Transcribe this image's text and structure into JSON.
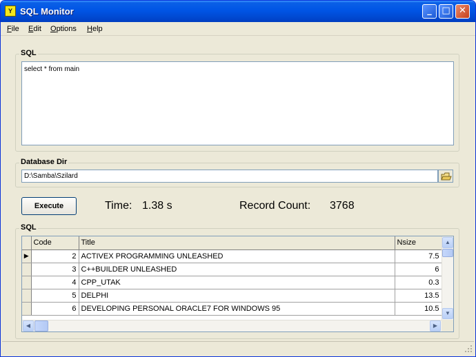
{
  "window": {
    "title": "SQL Monitor",
    "app_icon_glyph": "Y",
    "minimize": "_",
    "maximize": "□",
    "close": "✕"
  },
  "menu": [
    {
      "key": "F",
      "rest": "ile"
    },
    {
      "key": "E",
      "rest": "dit"
    },
    {
      "key": "O",
      "rest": "ptions"
    },
    {
      "key": "H",
      "rest": "elp"
    }
  ],
  "sql_group": {
    "label": "SQL",
    "query": "select * from main"
  },
  "dir_group": {
    "label": "Database Dir",
    "path": "D:\\Samba\\Szilard"
  },
  "actions": {
    "execute_label": "Execute"
  },
  "stats": {
    "time_label": "Time:",
    "time_value": "1.38 s",
    "count_label": "Record Count:",
    "count_value": "3768"
  },
  "results_group": {
    "label": "SQL",
    "columns": [
      "Code",
      "Title",
      "Nsize"
    ],
    "rows": [
      {
        "code": "2",
        "title": "ACTIVEX PROGRAMMING UNLEASHED",
        "nsize": "7.5"
      },
      {
        "code": "3",
        "title": "C++BUILDER UNLEASHED",
        "nsize": "6"
      },
      {
        "code": "4",
        "title": "CPP_UTAK",
        "nsize": "0.3"
      },
      {
        "code": "5",
        "title": "DELPHI",
        "nsize": "13.5"
      },
      {
        "code": "6",
        "title": "DEVELOPING PERSONAL ORACLE7 FOR WINDOWS 95",
        "nsize": "10.5"
      }
    ],
    "current_row_indicator": "▶"
  },
  "colors": {
    "titlebar": "#0055e5",
    "window_bg": "#ece9d8",
    "field_border": "#7f9db9"
  },
  "icons": [
    "app-icon",
    "minimize-icon",
    "maximize-icon",
    "close-icon",
    "folder-browse-icon",
    "scroll-up-icon",
    "scroll-down-icon",
    "scroll-left-icon",
    "scroll-right-icon",
    "size-grip-icon"
  ]
}
